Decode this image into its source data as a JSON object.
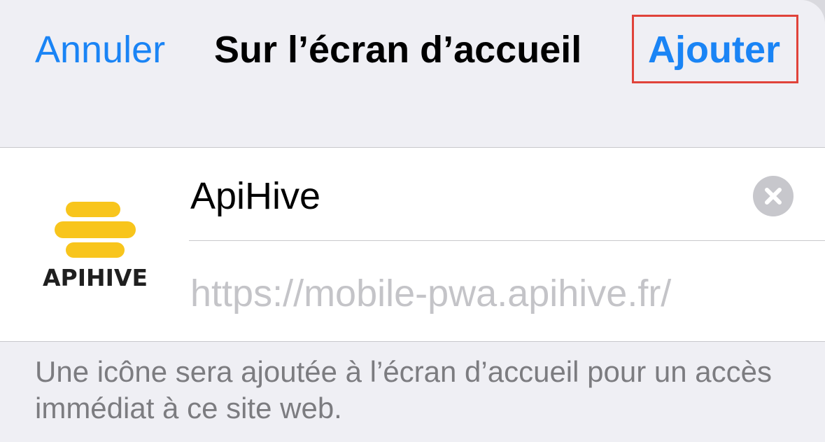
{
  "navbar": {
    "cancel_label": "Annuler",
    "title": "Sur l’écran d’accueil",
    "add_label": "Ajouter"
  },
  "app": {
    "icon_wordmark": "APIHIVE",
    "name_value": "ApiHive",
    "url": "https://mobile-pwa.apihive.fr/"
  },
  "footer": {
    "note": "Une icône sera ajoutée à l’écran d’accueil pour un accès immédiat à ce site web."
  },
  "colors": {
    "accent": "#1a84f5",
    "highlight_border": "#e0433a",
    "brand_yellow": "#f8c51c",
    "background": "#efeff4"
  },
  "icons": {
    "clear": "x-circle-icon",
    "app": "apihive-logo-icon"
  }
}
